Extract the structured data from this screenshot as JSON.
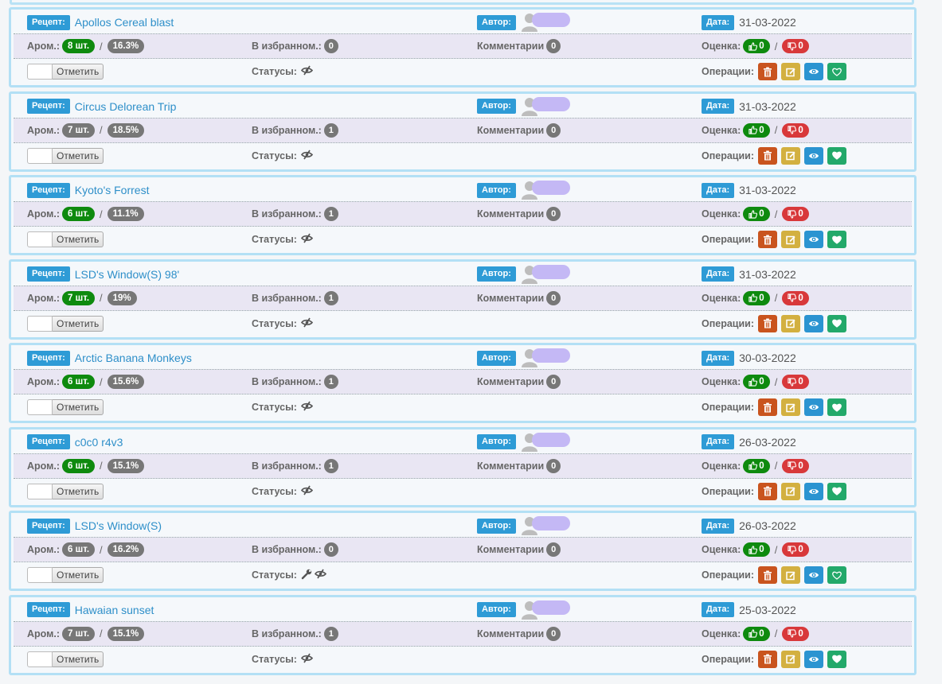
{
  "labels": {
    "recipe": "Рецепт:",
    "author": "Автор:",
    "date": "Дата:",
    "arom": "Аром.:",
    "fav": "В избранном.:",
    "comments": "Комментарии",
    "rating": "Оценка:",
    "statuses": "Статусы:",
    "operations": "Операции:",
    "mark": "Отметить",
    "slash": "/",
    "pcs_suffix": "шт."
  },
  "colors": {
    "tag_blue": "#2e9bd6",
    "like_green": "#0e8a0e",
    "dislike_red": "#d8383a",
    "delete": "#c9541e",
    "edit": "#d3b040",
    "view": "#2b94d1",
    "favorite": "#23a96a"
  },
  "recipes": [
    {
      "title": "Apollos Cereal blast",
      "date": "31-03-2022",
      "arom_count": "8 шт.",
      "arom_count_highlight": true,
      "percent": "16.3%",
      "fav": "0",
      "comments": "0",
      "likes": "0",
      "dislikes": "0",
      "status_icons": [
        "eye-slash-icon"
      ],
      "fav_filled": false
    },
    {
      "title": "Circus Delorean Trip",
      "date": "31-03-2022",
      "arom_count": "7 шт.",
      "arom_count_highlight": false,
      "percent": "18.5%",
      "fav": "1",
      "comments": "0",
      "likes": "0",
      "dislikes": "0",
      "status_icons": [
        "eye-slash-icon"
      ],
      "fav_filled": true
    },
    {
      "title": "Kyoto's Forrest",
      "date": "31-03-2022",
      "arom_count": "6 шт.",
      "arom_count_highlight": true,
      "percent": "11.1%",
      "fav": "1",
      "comments": "0",
      "likes": "0",
      "dislikes": "0",
      "status_icons": [
        "eye-slash-icon"
      ],
      "fav_filled": true
    },
    {
      "title": "LSD's Window(S) 98'",
      "date": "31-03-2022",
      "arom_count": "7 шт.",
      "arom_count_highlight": true,
      "percent": "19%",
      "fav": "1",
      "comments": "0",
      "likes": "0",
      "dislikes": "0",
      "status_icons": [
        "eye-slash-icon"
      ],
      "fav_filled": true
    },
    {
      "title": "Arctic Banana Monkeys",
      "date": "30-03-2022",
      "arom_count": "6 шт.",
      "arom_count_highlight": true,
      "percent": "15.6%",
      "fav": "1",
      "comments": "0",
      "likes": "0",
      "dislikes": "0",
      "status_icons": [
        "eye-slash-icon"
      ],
      "fav_filled": true
    },
    {
      "title": "c0c0 r4v3",
      "date": "26-03-2022",
      "arom_count": "6 шт.",
      "arom_count_highlight": true,
      "percent": "15.1%",
      "fav": "1",
      "comments": "0",
      "likes": "0",
      "dislikes": "0",
      "status_icons": [
        "eye-slash-icon"
      ],
      "fav_filled": true
    },
    {
      "title": "LSD's Window(S)",
      "date": "26-03-2022",
      "arom_count": "6 шт.",
      "arom_count_highlight": false,
      "percent": "16.2%",
      "fav": "0",
      "comments": "0",
      "likes": "0",
      "dislikes": "0",
      "status_icons": [
        "wrench-icon",
        "eye-slash-icon"
      ],
      "fav_filled": false
    },
    {
      "title": "Hawaian sunset",
      "date": "25-03-2022",
      "arom_count": "7 шт.",
      "arom_count_highlight": false,
      "percent": "15.1%",
      "fav": "1",
      "comments": "0",
      "likes": "0",
      "dislikes": "0",
      "status_icons": [
        "eye-slash-icon"
      ],
      "fav_filled": true
    }
  ]
}
